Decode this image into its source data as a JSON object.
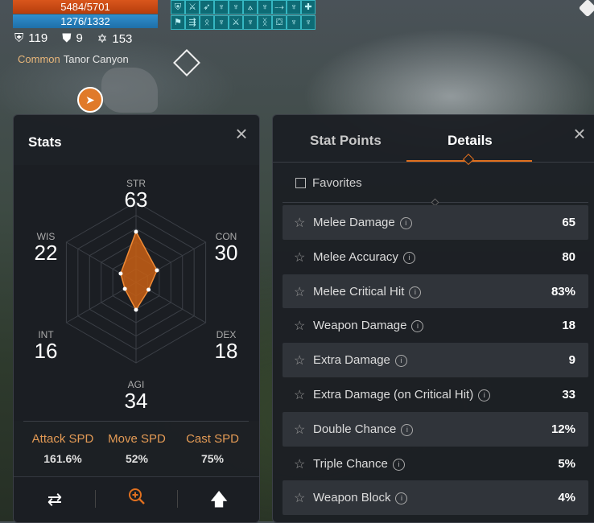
{
  "hud": {
    "hp": "5484/5701",
    "mp": "1276/1332",
    "stat_a": "119",
    "stat_b": "9",
    "stat_c": "153",
    "zone_rarity": "Common",
    "zone_name": "Tanor Canyon",
    "buff_icons": [
      "shield-buff-icon",
      "sword-buff-icon",
      "arrow-buff-icon",
      "figure-buff-icon",
      "figure-buff-icon",
      "wings-buff-icon",
      "figure-buff-icon",
      "dash-buff-icon",
      "figure-buff-icon",
      "cross-buff-icon",
      "boot-buff-icon",
      "speed-buff-icon",
      "rune-buff-icon",
      "figure-buff-icon",
      "sword-buff-icon",
      "figure-buff-icon",
      "glyph-buff-icon",
      "chest-buff-icon",
      "figure-buff-icon",
      "figure-buff-icon"
    ]
  },
  "stats_panel": {
    "title": "Stats",
    "radar": {
      "max": 100,
      "stats": [
        {
          "name": "STR",
          "value": "63",
          "level": 63
        },
        {
          "name": "CON",
          "value": "30",
          "level": 30
        },
        {
          "name": "DEX",
          "value": "18",
          "level": 18
        },
        {
          "name": "AGI",
          "value": "34",
          "level": 34
        },
        {
          "name": "INT",
          "value": "16",
          "level": 16
        },
        {
          "name": "WIS",
          "value": "22",
          "level": 22
        }
      ]
    },
    "speeds": [
      {
        "name": "Attack SPD",
        "value": "161.6%"
      },
      {
        "name": "Move SPD",
        "value": "52%"
      },
      {
        "name": "Cast SPD",
        "value": "75%"
      }
    ]
  },
  "details_panel": {
    "tabs": [
      "Stat Points",
      "Details"
    ],
    "active_tab": "Details",
    "favorites_label": "Favorites",
    "rows": [
      {
        "label": "Melee Damage",
        "value": "65"
      },
      {
        "label": "Melee Accuracy",
        "value": "80"
      },
      {
        "label": "Melee Critical Hit",
        "value": "83%"
      },
      {
        "label": "Weapon Damage",
        "value": "18"
      },
      {
        "label": "Extra Damage",
        "value": "9"
      },
      {
        "label": "Extra Damage (on Critical Hit)",
        "value": "33"
      },
      {
        "label": "Double Chance",
        "value": "12%"
      },
      {
        "label": "Triple Chance",
        "value": "5%"
      },
      {
        "label": "Weapon Block",
        "value": "4%"
      }
    ]
  },
  "colors": {
    "accent": "#e0701f",
    "hp": "#c9480f",
    "mp": "#2a84c4",
    "radar_fill": "#c85f14"
  }
}
